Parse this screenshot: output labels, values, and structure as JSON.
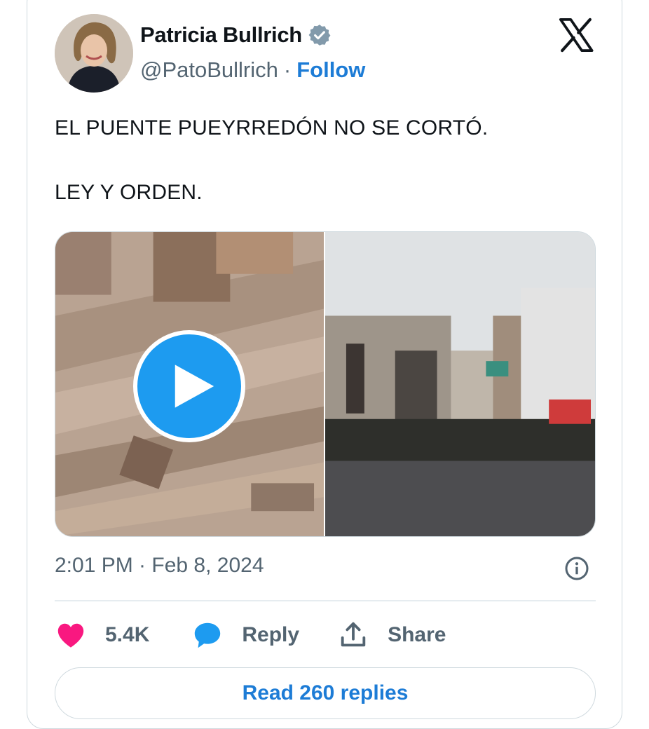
{
  "tweet": {
    "author_name": "Patricia Bullrich",
    "handle": "@PatoBullrich",
    "separator": "·",
    "follow_label": "Follow",
    "verified_icon": "verified-badge-icon",
    "platform_icon": "x-logo-icon",
    "text_lines": [
      "EL PUENTE PUEYRREDÓN NO SE CORTÓ.",
      "LEY Y ORDEN."
    ],
    "timestamp": "2:01 PM · Feb 8, 2024",
    "media": [
      {
        "type": "video",
        "icon": "play-icon"
      },
      {
        "type": "image"
      }
    ]
  },
  "actions": {
    "like_count": "5.4K",
    "reply_label": "Reply",
    "share_label": "Share"
  },
  "read_replies_label": "Read 260 replies",
  "colors": {
    "accent": "#1d9bf0",
    "link": "#1d7cd6",
    "like": "#f91880",
    "muted": "#536471",
    "badge": "#829aab"
  }
}
